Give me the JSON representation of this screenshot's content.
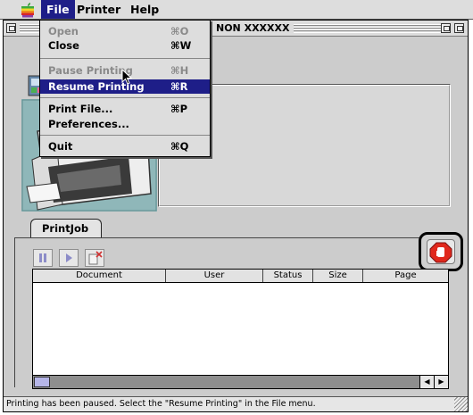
{
  "menubar": {
    "menus": [
      "File",
      "Printer",
      "Help"
    ]
  },
  "window": {
    "title": "NON XXXXXX"
  },
  "file_menu": {
    "items": [
      {
        "label": "Open",
        "shortcut": "⌘O",
        "state": "disabled"
      },
      {
        "label": "Close",
        "shortcut": "⌘W",
        "state": "enabled"
      },
      {
        "label": "Pause Printing",
        "shortcut": "⌘H",
        "state": "disabled"
      },
      {
        "label": "Resume Printing",
        "shortcut": "⌘R",
        "state": "selected"
      },
      {
        "label": "Print File...",
        "shortcut": "⌘P",
        "state": "enabled"
      },
      {
        "label": "Preferences...",
        "shortcut": "",
        "state": "enabled"
      },
      {
        "label": "Quit",
        "shortcut": "⌘Q",
        "state": "enabled"
      }
    ]
  },
  "printjob": {
    "tab_label": "PrintJob",
    "columns": [
      "Document",
      "User",
      "Status",
      "Size",
      "Page"
    ]
  },
  "status_bar": {
    "text": "Printing has been paused. Select the \"Resume Printing\" in the File menu."
  },
  "colors": {
    "highlight": "#1e1e88",
    "stop": "#e0281c"
  }
}
